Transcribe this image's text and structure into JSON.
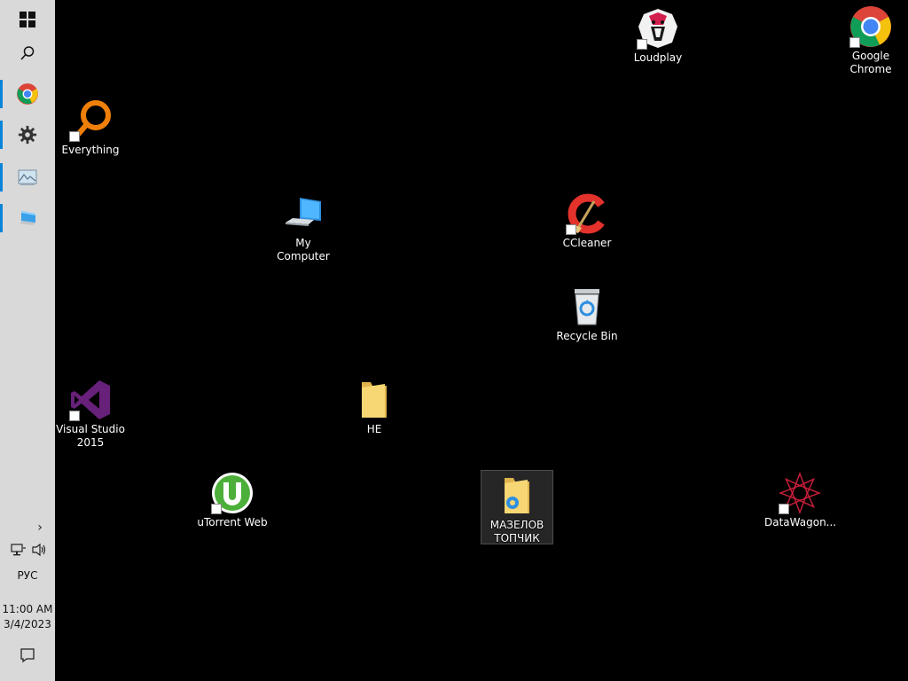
{
  "taskbar": {
    "buttons": [
      {
        "name": "Start",
        "icon": "windows-logo-icon"
      },
      {
        "name": "Search",
        "icon": "search-icon"
      },
      {
        "name": "Google Chrome",
        "icon": "chrome-icon",
        "running": true
      },
      {
        "name": "Settings",
        "icon": "gear-icon",
        "running": true
      },
      {
        "name": "Pictures app",
        "icon": "image-viewer-icon",
        "running": true
      },
      {
        "name": "Remote Desktop",
        "icon": "remote-desktop-icon",
        "running": true
      }
    ],
    "language": "РУС",
    "time": "11:00 AM",
    "date": "3/4/2023"
  },
  "desktop": {
    "icons": [
      {
        "id": "loudplay",
        "label": "Loudplay",
        "icon": "loudplay-lion-icon",
        "shortcut": true
      },
      {
        "id": "chrome",
        "label": "Google\nChrome",
        "icon": "chrome-icon",
        "shortcut": true
      },
      {
        "id": "everything",
        "label": "Everything",
        "icon": "everything-search-icon",
        "shortcut": true
      },
      {
        "id": "my-computer",
        "label": "My Computer",
        "icon": "computer-icon",
        "shortcut": false
      },
      {
        "id": "ccleaner",
        "label": "CCleaner",
        "icon": "ccleaner-icon",
        "shortcut": true
      },
      {
        "id": "recycle-bin",
        "label": "Recycle Bin",
        "icon": "recycle-bin-icon",
        "shortcut": false
      },
      {
        "id": "visual-studio",
        "label": "Visual Studio\n2015",
        "icon": "visual-studio-icon",
        "shortcut": true
      },
      {
        "id": "folder-he",
        "label": "НЕ",
        "icon": "folder-icon",
        "shortcut": false
      },
      {
        "id": "utorrent",
        "label": "uTorrent Web",
        "icon": "utorrent-icon",
        "shortcut": true
      },
      {
        "id": "mazelov",
        "label": "МАЗЕЛОВ\nТОПЧИК",
        "icon": "folder-icon",
        "shortcut": false,
        "selected": true
      },
      {
        "id": "datawagon",
        "label": "DataWagon...",
        "icon": "datawagon-icon",
        "shortcut": true
      }
    ]
  },
  "colors": {
    "taskbar": "#d9d9d9",
    "accent": "#0a84d8",
    "desktop": "#000000"
  }
}
